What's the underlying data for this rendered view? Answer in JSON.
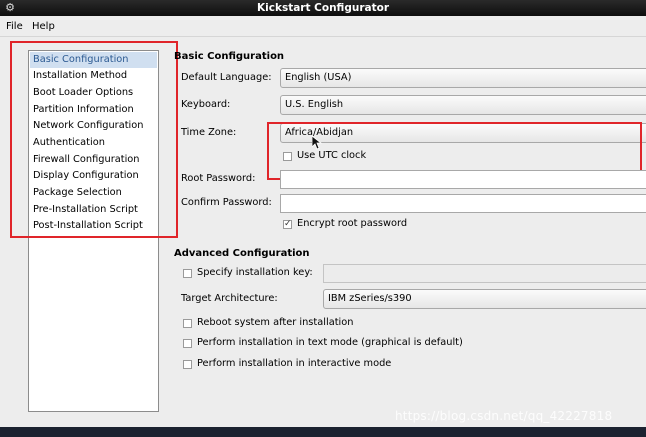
{
  "window": {
    "title": "Kickstart Configurator",
    "app_icon": "kickstart-app-icon"
  },
  "menubar": {
    "items": [
      {
        "label": "File"
      },
      {
        "label": "Help"
      }
    ]
  },
  "sidebar": {
    "items": [
      {
        "label": "Basic Configuration",
        "selected": true
      },
      {
        "label": "Installation Method"
      },
      {
        "label": "Boot Loader Options"
      },
      {
        "label": "Partition Information"
      },
      {
        "label": "Network Configuration"
      },
      {
        "label": "Authentication"
      },
      {
        "label": "Firewall Configuration"
      },
      {
        "label": "Display Configuration"
      },
      {
        "label": "Package Selection"
      },
      {
        "label": "Pre-Installation Script"
      },
      {
        "label": "Post-Installation Script"
      }
    ]
  },
  "basic": {
    "title": "Basic Configuration",
    "default_language_label": "Default Language:",
    "default_language_value": "English (USA)",
    "keyboard_label": "Keyboard:",
    "keyboard_value": "U.S. English",
    "time_zone_label": "Time Zone:",
    "time_zone_value": "Africa/Abidjan",
    "utc_label": "Use UTC clock",
    "utc_checked": false,
    "root_password_label": "Root Password:",
    "root_password_value": "",
    "confirm_password_label": "Confirm Password:",
    "confirm_password_value": "",
    "encrypt_label": "Encrypt root password",
    "encrypt_checked": true
  },
  "advanced": {
    "title": "Advanced Configuration",
    "install_key_label": "Specify installation key:",
    "install_key_checked": false,
    "install_key_value": "",
    "target_arch_label": "Target Architecture:",
    "target_arch_value": "IBM zSeries/s390",
    "reboot_label": "Reboot system after installation",
    "reboot_checked": false,
    "text_mode_label": "Perform installation in text mode (graphical is default)",
    "text_mode_checked": false,
    "interactive_label": "Perform installation in interactive mode",
    "interactive_checked": false
  },
  "watermark": "https://blog.csdn.net/qq_42227818",
  "colors": {
    "highlight_box": "#e0252a",
    "selection_bg": "#d0dff0",
    "selection_text": "#2c5a92"
  }
}
